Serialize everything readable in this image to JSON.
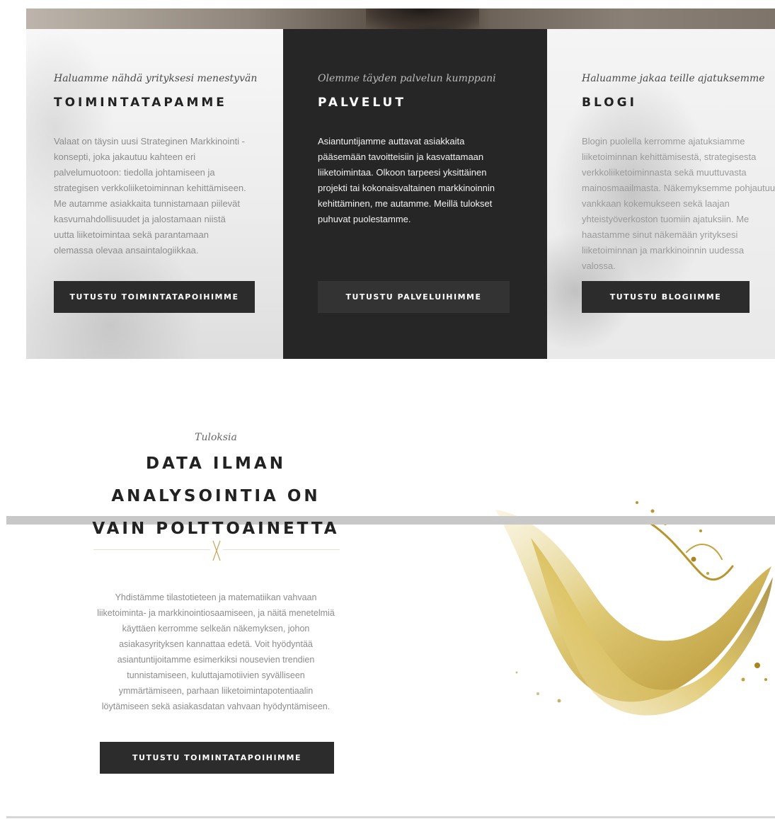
{
  "columns": [
    {
      "kicker": "Haluamme nähdä yrityksesi menestyvän",
      "title": "TOIMINTATAPAMME",
      "text": "Valaat on täysin uusi Strateginen Markkinointi -konsepti, joka jakautuu kahteen eri palvelumuotoon: tiedolla johtamiseen ja strategisen verkkoliiketoiminnan kehittämiseen. Me autamme asiakkaita tunnistamaan piilevät kasvumahdollisuudet ja jalostamaan niistä uutta liiketoimintaa sekä parantamaan olemassa olevaa ansaintalogiikkaa.",
      "button": "TUTUSTU TOIMINTATAPOIHIMME"
    },
    {
      "kicker": "Olemme täyden palvelun kumppani",
      "title": "PALVELUT",
      "text": "Asiantuntijamme auttavat asiakkaita pääsemään tavoitteisiin ja kasvattamaan liiketoimintaa. Olkoon tarpeesi yksittäinen projekti tai kokonaisvaltainen markkinoinnin kehittäminen, me autamme. Meillä tulokset puhuvat puolestamme.",
      "button": "TUTUSTU PALVELUIHIMME"
    },
    {
      "kicker": "Haluamme jakaa teille ajatuksemme",
      "title": "BLOGI",
      "text": "Blogin puolella kerromme ajatuksiamme liiketoiminnan kehittämisestä, strategisesta verkkoliiketoiminnasta sekä muuttuvasta mainosmaailmasta. Näkemyksemme pohjautuu vankkaan kokemukseen sekä laajan yhteistyöverkoston tuomiin ajatuksiin. Me haastamme sinut näkemään yrityksesi liiketoiminnan ja markkinoinnin uudessa valossa.",
      "button": "TUTUSTU BLOGIIMME"
    }
  ],
  "results": {
    "kicker": "Tuloksia",
    "title": "DATA ILMAN ANALYSOINTIA ON VAIN POLTTOAINETTA",
    "text": "Yhdistämme tilastotieteen ja matematiikan vahvaan liiketoiminta- ja markkinointiosaamiseen, ja näitä menetelmiä käyttäen kerromme selkeän näkemyksen, johon asiakasyrityksen kannattaa edetä. Voit hyödyntää asiantuntijoitamme esimerkiksi nousevien trendien tunnistamiseen, kuluttajamotiivien syvälliseen ymmärtämiseen, parhaan liiketoimintapotentiaalin löytämiseen sekä asiakasdatan vahvaan hyödyntämiseen.",
    "button": "TUTUSTU TOIMINTATAPOIHIMME"
  },
  "icons": {
    "divider": "crossed-lines-icon",
    "illustration": "oil-splash-illustration"
  },
  "colors": {
    "dark_panel": "#262626",
    "button": "#2c2c2c",
    "accent_gold": "#c9a55a",
    "oil": "#d6b849"
  }
}
